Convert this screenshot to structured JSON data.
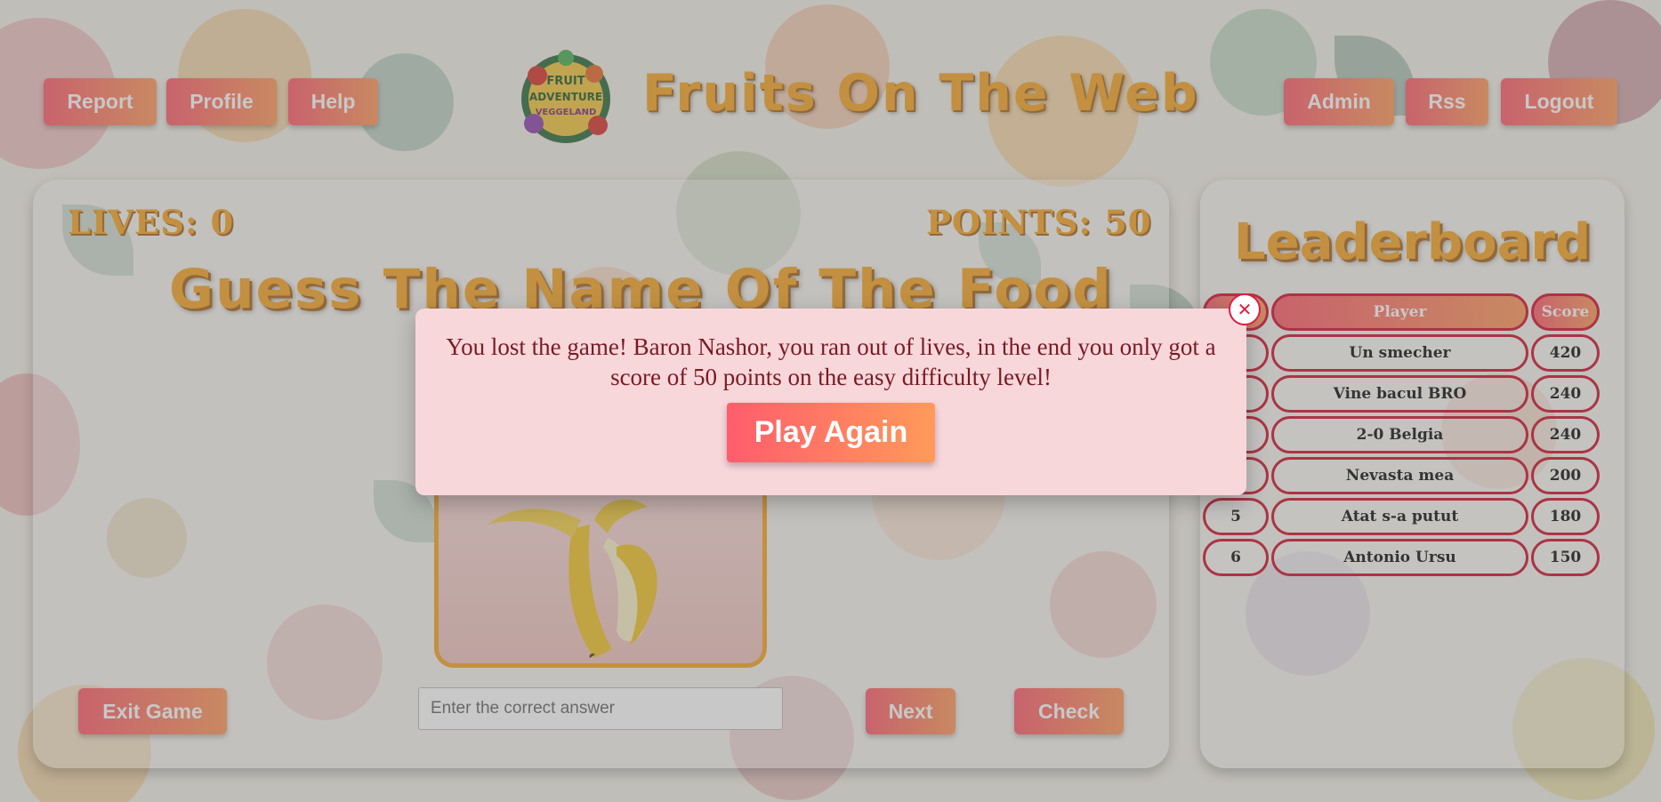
{
  "header": {
    "site_title": "Fruits On The Web",
    "logo_text": [
      "FRUIT",
      "ADVENTURE",
      "VEGGELAND"
    ],
    "nav_left": [
      "Report",
      "Profile",
      "Help"
    ],
    "nav_right": [
      "Admin",
      "Rss",
      "Logout"
    ]
  },
  "game": {
    "lives_label": "LIVES: 0",
    "points_label": "POINTS: 50",
    "title": "Guess The Name Of The Food",
    "answer_placeholder": "Enter the correct answer",
    "exit_label": "Exit Game",
    "next_label": "Next",
    "check_label": "Check"
  },
  "leaderboard": {
    "title": "Leaderboard",
    "headers": {
      "rank": "",
      "player": "Player",
      "score": "Score"
    },
    "rows": [
      {
        "rank": "",
        "player": "Un smecher",
        "score": "420"
      },
      {
        "rank": "",
        "player": "Vine bacul BRO",
        "score": "240"
      },
      {
        "rank": "",
        "player": "2-0 Belgia",
        "score": "240"
      },
      {
        "rank": "",
        "player": "Nevasta mea",
        "score": "200"
      },
      {
        "rank": "5",
        "player": "Atat s-a putut",
        "score": "180"
      },
      {
        "rank": "6",
        "player": "Antonio Ursu",
        "score": "150"
      }
    ]
  },
  "modal": {
    "message": "You lost the game! Baron Nashor, you ran out of lives, in the end you only got a score of 50 points on the easy difficulty level!",
    "play_again_label": "Play Again",
    "close_glyph": "✕"
  },
  "colors": {
    "accent_gradient_start": "#ff5d6c",
    "accent_gradient_end": "#ff9a5a",
    "title_orange": "#f5a524",
    "leaderboard_border": "#d0112b",
    "modal_bg": "#f8d7db"
  }
}
